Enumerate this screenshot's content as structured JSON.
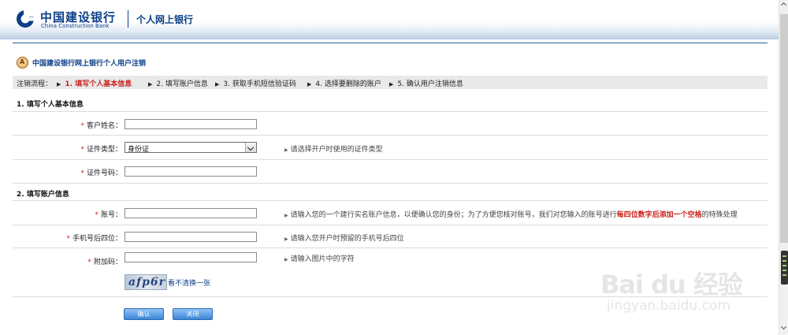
{
  "header": {
    "bank_name_cn": "中国建设银行",
    "bank_name_en": "China Construction Bank",
    "product": "个人网上银行",
    "brand_color": "#0b3e86"
  },
  "page": {
    "title": "中国建设银行网上银行个人用户注销"
  },
  "process": {
    "label": "注销流程：",
    "steps": [
      "1. 填写个人基本信息",
      "2. 填写账户信息",
      "3. 获取手机短信验证码",
      "4. 选择要删除的账户",
      "5. 确认用户注销信息"
    ],
    "active_index": 0,
    "active_color": "#c8231d"
  },
  "section1": {
    "title": "1. 填写个人基本信息",
    "name_label": "客户姓名：",
    "name_value": "",
    "idtype_label": "证件类型：",
    "idtype_value": "身份证",
    "idtype_hint": "请选择开户时使用的证件类型",
    "idnum_label": "证件号码：",
    "idnum_value": ""
  },
  "section2": {
    "title": "2. 填写账户信息",
    "account_label": "账号：",
    "account_value": "",
    "account_hint_pre": "请输入您的一个建行实名账户信息，以便确认您的身份；为了方便您核对账号，我们对您输入的账号进行",
    "account_hint_hl": "每四位数字后添加一个空格",
    "account_hint_post": "的特殊处理",
    "phone_label": "手机号后四位：",
    "phone_value": "",
    "phone_hint": "请输入您开户时预留的手机号后四位",
    "code_label": "附加码：",
    "code_value": "",
    "code_hint": "请输入图片中的字符",
    "captcha_text": "afp6r",
    "refresh_link": "看不清换一张"
  },
  "buttons": {
    "confirm": "确认",
    "close": "关闭"
  },
  "watermark": {
    "main": "Bai du 经验",
    "sub": "jingyan.baidu.com"
  },
  "required_mark": "*"
}
